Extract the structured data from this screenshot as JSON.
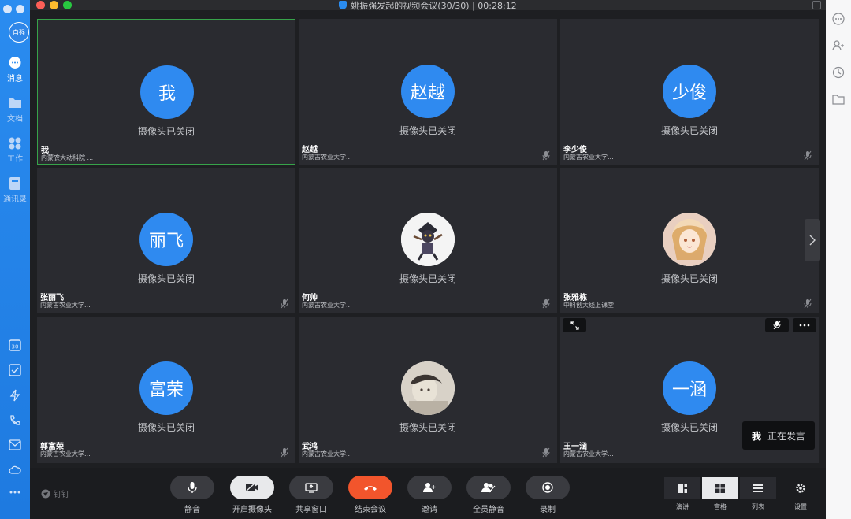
{
  "window": {
    "title": "姚振强发起的视频会议(30/30) | 00:28:12"
  },
  "sidebar": {
    "avatar_text": "自强",
    "items": [
      {
        "label": "消息",
        "icon": "chat-icon"
      },
      {
        "label": "文档",
        "icon": "folder-icon"
      },
      {
        "label": "工作",
        "icon": "grid-icon"
      },
      {
        "label": "通讯录",
        "icon": "contacts-icon"
      }
    ],
    "bottom_icons": [
      "calendar-icon",
      "todo-check-icon",
      "flash-icon",
      "phone-icon",
      "mail-icon",
      "cloud-icon",
      "more-dots-icon"
    ],
    "calendar_day": "30"
  },
  "right_panel": {
    "icons": [
      "more-icon",
      "add-person-icon",
      "history-clock-icon",
      "file-folder-icon"
    ]
  },
  "participants": [
    {
      "avatar_text": "我",
      "name": "我",
      "org": "内蒙农大动科院 ...",
      "status": "摄像头已关闭",
      "active": true,
      "muted": false
    },
    {
      "avatar_text": "赵越",
      "name": "赵越",
      "org": "内蒙古农业大学...",
      "status": "摄像头已关闭",
      "muted": true
    },
    {
      "avatar_text": "少俊",
      "name": "李少俊",
      "org": "内蒙古农业大学...",
      "status": "摄像头已关闭",
      "muted": true
    },
    {
      "avatar_text": "丽飞",
      "name": "张丽飞",
      "org": "内蒙古农业大学...",
      "status": "摄像头已关闭",
      "muted": true
    },
    {
      "avatar_text": "",
      "name": "何帅",
      "org": "内蒙古农业大学...",
      "status": "摄像头已关闭",
      "muted": true,
      "avatar_image": "cartoon-character"
    },
    {
      "avatar_text": "",
      "name": "张雅栋",
      "org": "中科创大线上课堂",
      "status": "摄像头已关闭",
      "muted": true,
      "avatar_image": "anime-girl"
    },
    {
      "avatar_text": "富荣",
      "name": "郭富荣",
      "org": "内蒙古农业大学...",
      "status": "摄像头已关闭",
      "muted": true
    },
    {
      "avatar_text": "",
      "name": "武鸿",
      "org": "内蒙古农业大学...",
      "status": "摄像头已关闭",
      "muted": true,
      "avatar_image": "photo-person"
    },
    {
      "avatar_text": "一涵",
      "name": "王一涵",
      "org": "内蒙古农业大学...",
      "status": "摄像头已关闭",
      "muted": false
    }
  ],
  "speaking": {
    "who": "我",
    "text": "正在发言"
  },
  "toolbar": {
    "brand": "钉钉",
    "buttons": [
      {
        "label": "静音",
        "icon": "microphone-icon"
      },
      {
        "label": "开启摄像头",
        "icon": "camera-icon"
      },
      {
        "label": "共享窗口",
        "icon": "screen-share-icon"
      },
      {
        "label": "结束会议",
        "icon": "hangup-icon"
      },
      {
        "label": "邀请",
        "icon": "invite-icon"
      },
      {
        "label": "全员静音",
        "icon": "mute-all-icon"
      },
      {
        "label": "录制",
        "icon": "record-icon"
      }
    ],
    "layouts": [
      {
        "label": "演讲",
        "icon": "speaker-layout-icon"
      },
      {
        "label": "宫格",
        "icon": "grid-layout-icon",
        "selected": true
      },
      {
        "label": "列表",
        "icon": "list-layout-icon"
      }
    ],
    "settings_label": "设置"
  },
  "colors": {
    "accent": "#2f8af0",
    "end_call": "#f2552c",
    "active_border": "#37a34a",
    "sidebar": "#2a8cf0"
  }
}
